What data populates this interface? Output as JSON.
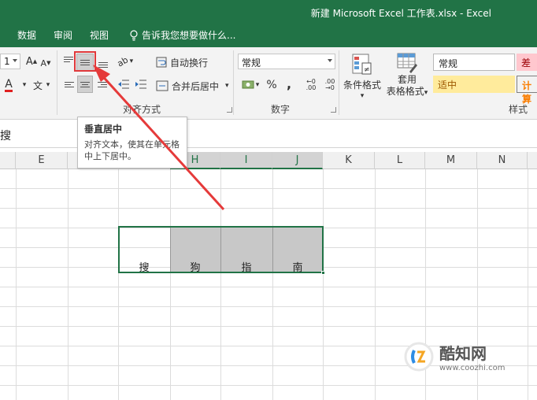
{
  "window": {
    "title": "新建 Microsoft Excel 工作表.xlsx - Excel"
  },
  "tabs": [
    {
      "label": "数据"
    },
    {
      "label": "审阅"
    },
    {
      "label": "视图"
    }
  ],
  "tellme": {
    "text": "告诉我您想要做什么..."
  },
  "ribbon": {
    "font_size_partial": "1",
    "font_grow": "A",
    "font_shrink": "A",
    "font_color_letter": "A",
    "wen_glyph": "文",
    "orientation_glyph": "ab",
    "wrap_text_label": "自动换行",
    "merge_center_label": "合并后居中",
    "alignment_group_label": "对齐方式",
    "number_format_value": "常规",
    "percent_label": "%",
    "comma_label": ",",
    "inc_decimal_label": "←0 .00",
    "dec_decimal_label": ".00 →0",
    "number_group_label": "数字",
    "cond_format_label": "条件格式",
    "table_format_label_1": "套用",
    "table_format_label_2": "表格格式",
    "styles_group_label": "样式",
    "style_normal": "常规",
    "style_bad": "差",
    "style_neutral": "适中",
    "style_calc": "计算"
  },
  "tooltip": {
    "title": "垂直居中",
    "body": "对齐文本，使其在单元格中上下居中。"
  },
  "formula_bar": {
    "content": "搜"
  },
  "columns": [
    "E",
    "",
    "",
    "H",
    "I",
    "J",
    "K",
    "L",
    "M",
    "N"
  ],
  "cells": [
    {
      "value": "搜"
    },
    {
      "value": "狗"
    },
    {
      "value": "指"
    },
    {
      "value": "南"
    }
  ],
  "watermark": {
    "main": "酷知网",
    "sub": "www.coozhi.com"
  },
  "colors": {
    "excel_green": "#217346",
    "highlight_red": "#e0393b",
    "arrow_red": "#e53a3a",
    "cell_shade": "#c8c8c8"
  }
}
